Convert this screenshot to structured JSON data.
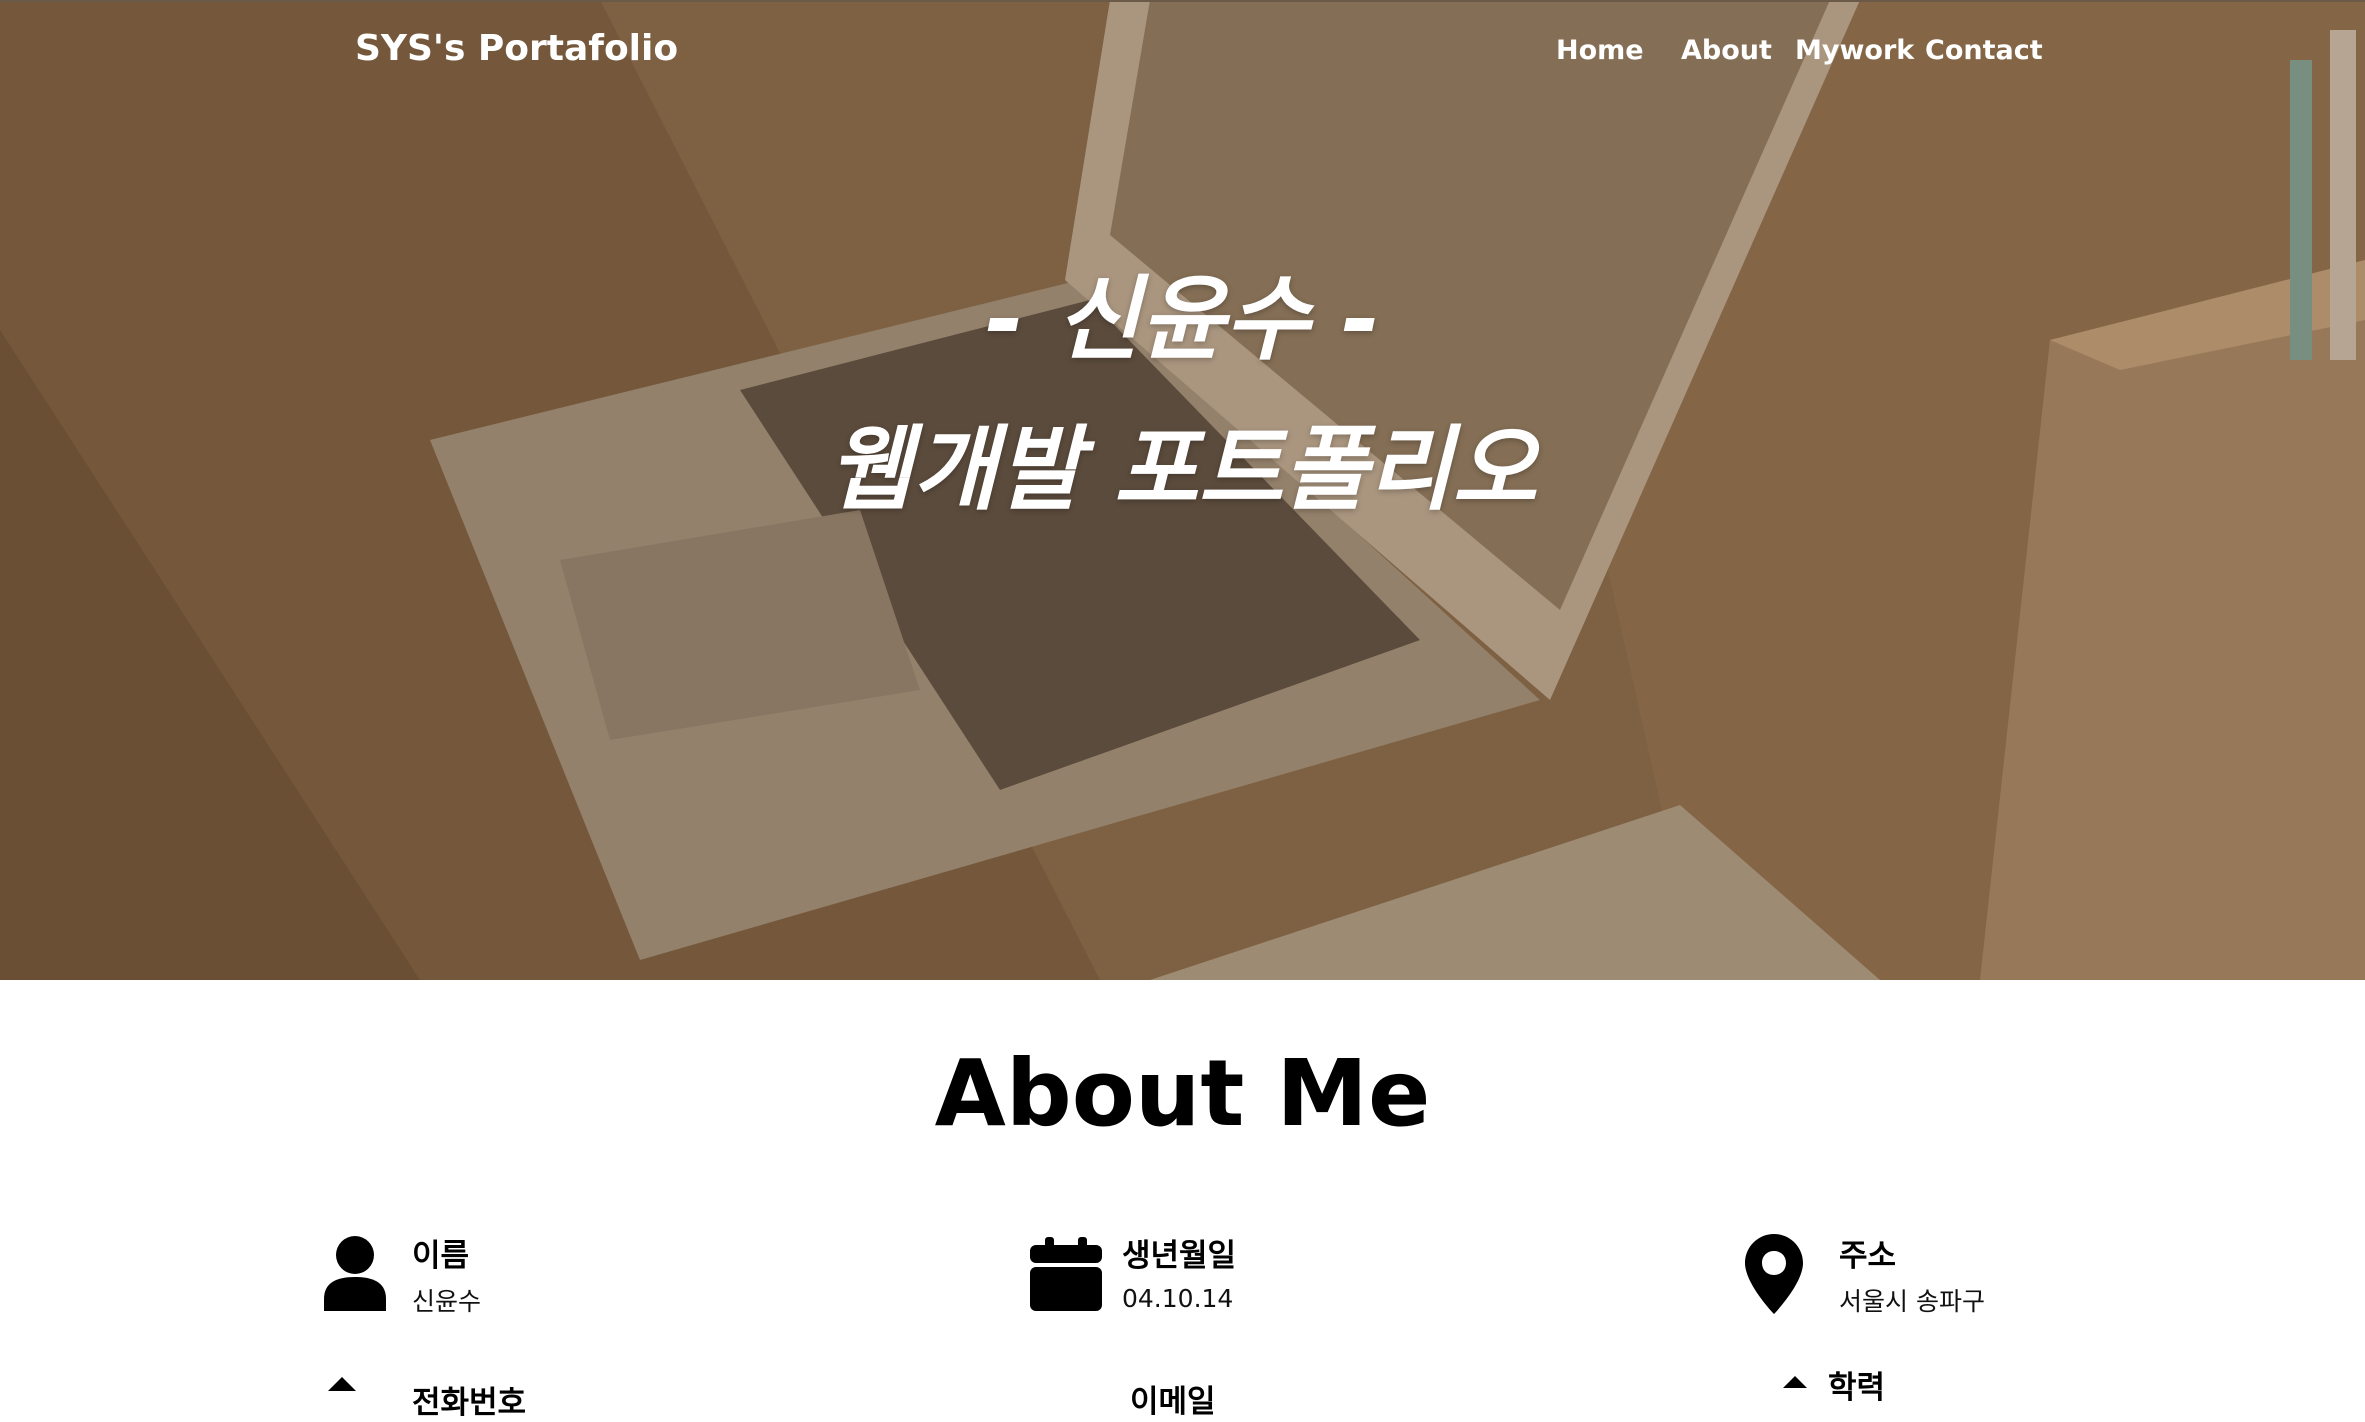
{
  "navbar": {
    "brand": "SYS's Portafolio",
    "links": [
      "Home",
      "About",
      "Mywork",
      "Contact"
    ]
  },
  "hero": {
    "line1": "- 신윤수 -",
    "line2": "웹개발 포트폴리오"
  },
  "about": {
    "title": "About Me",
    "items": [
      {
        "label": "이름",
        "value": "신윤수",
        "icon": "person-icon"
      },
      {
        "label": "생년월일",
        "value": "04.10.14",
        "icon": "calendar-icon"
      },
      {
        "label": "주소",
        "value": "서울시 송파구",
        "icon": "location-pin-icon"
      },
      {
        "label": "전화번호",
        "value": "",
        "icon": "phone-icon"
      },
      {
        "label": "이메일",
        "value": "",
        "icon": "email-icon"
      },
      {
        "label": "학력",
        "value": "",
        "icon": "graduation-cap-icon"
      }
    ]
  },
  "colors": {
    "hero_tint": "#8a6a45",
    "text_light": "#ffffff",
    "text_dark": "#000000"
  }
}
